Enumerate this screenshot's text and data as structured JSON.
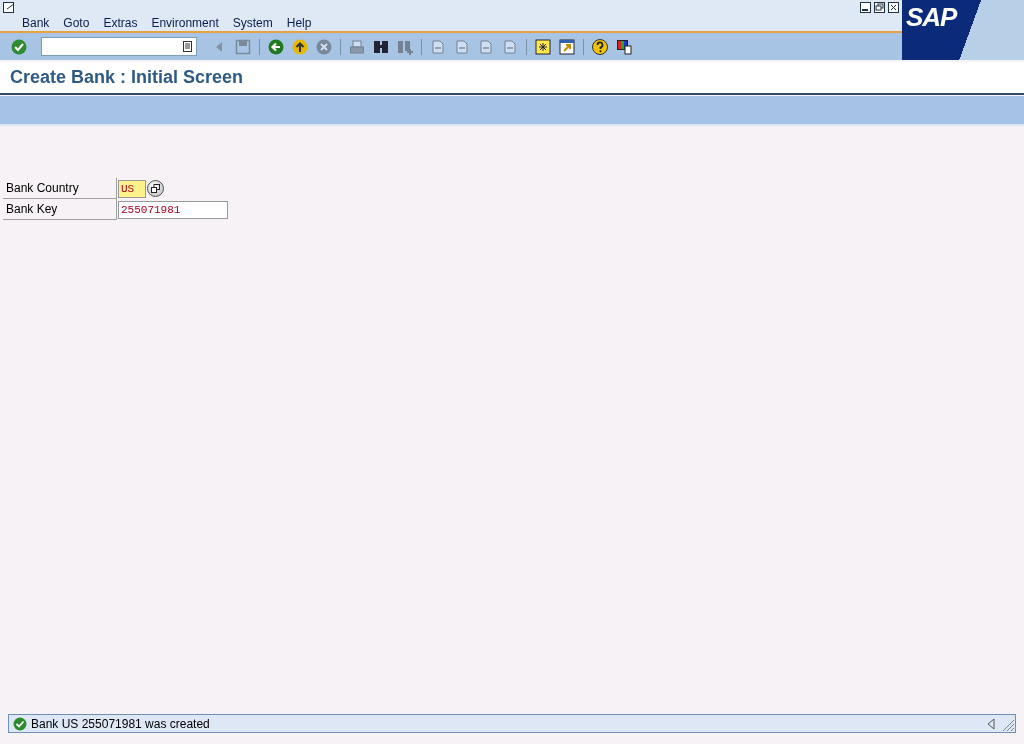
{
  "menu": [
    {
      "label": "Bank"
    },
    {
      "label": "Goto"
    },
    {
      "label": "Extras"
    },
    {
      "label": "Environment"
    },
    {
      "label": "System"
    },
    {
      "label": "Help"
    }
  ],
  "logo": "SAP",
  "toolbar": [
    {
      "kind": "enter",
      "disabled": false
    },
    {
      "kind": "command",
      "disabled": false
    },
    {
      "kind": "prev",
      "disabled": true
    },
    {
      "kind": "save",
      "disabled": true
    },
    {
      "kind": "sep"
    },
    {
      "kind": "back",
      "disabled": false
    },
    {
      "kind": "exit",
      "disabled": false
    },
    {
      "kind": "cancel",
      "disabled": true
    },
    {
      "kind": "sep"
    },
    {
      "kind": "print",
      "disabled": true
    },
    {
      "kind": "find",
      "disabled": false
    },
    {
      "kind": "findnext",
      "disabled": true
    },
    {
      "kind": "sep"
    },
    {
      "kind": "page",
      "disabled": true
    },
    {
      "kind": "page",
      "disabled": true
    },
    {
      "kind": "page",
      "disabled": true
    },
    {
      "kind": "page",
      "disabled": true
    },
    {
      "kind": "sep"
    },
    {
      "kind": "session",
      "disabled": false
    },
    {
      "kind": "shortcut",
      "disabled": false
    },
    {
      "kind": "sep"
    },
    {
      "kind": "help",
      "disabled": false
    },
    {
      "kind": "layout",
      "disabled": false
    }
  ],
  "title": "Create Bank : Initial Screen",
  "fields": [
    {
      "label": "Bank Country",
      "value": "US",
      "required": true,
      "help": true
    },
    {
      "label": "Bank Key",
      "value": "255071981",
      "required": false,
      "help": false
    }
  ],
  "status": {
    "kind": "success",
    "message": "Bank US 255071981 was created"
  }
}
